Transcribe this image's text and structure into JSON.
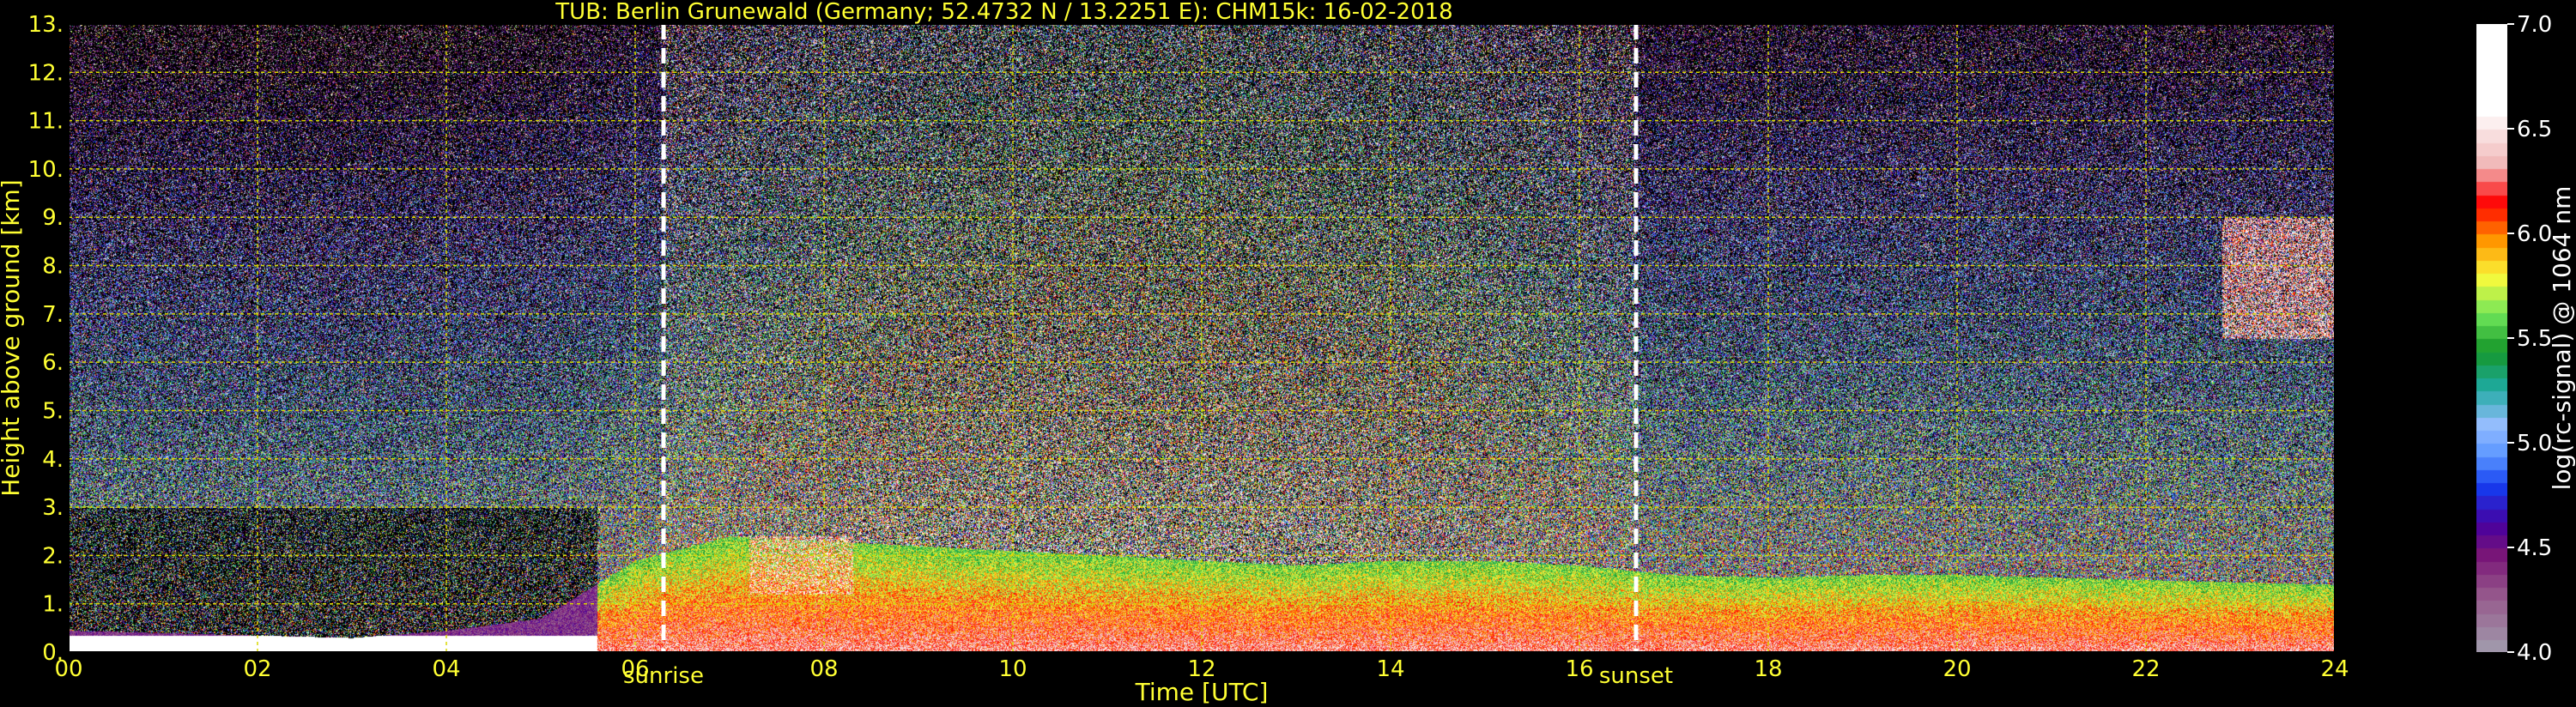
{
  "chart_data": {
    "type": "heatmap",
    "title": "TUB: Berlin Grunewald (Germany; 52.4732 N / 13.2251 E):    CHM15k: 16-02-2018",
    "xlabel": "Time [UTC]",
    "ylabel": "Height above ground [km]",
    "xlim": [
      0,
      24
    ],
    "ylim": [
      0,
      13
    ],
    "x_ticks": [
      "00",
      "02",
      "04",
      "06",
      "08",
      "10",
      "12",
      "14",
      "16",
      "18",
      "20",
      "22",
      "24"
    ],
    "y_ticks": [
      "0.",
      "1.",
      "2.",
      "3.",
      "4.",
      "5.",
      "6.",
      "7.",
      "8.",
      "9.",
      "10.",
      "11.",
      "12.",
      "13."
    ],
    "grid": true,
    "colorbar": {
      "label": "log(rc-signal) @ 1064 nm",
      "range": [
        4.0,
        7.0
      ],
      "ticks": [
        "4.0",
        "4.5",
        "5.0",
        "5.5",
        "6.0",
        "6.5",
        "7.0"
      ]
    },
    "annotations": [
      {
        "label": "sunrise",
        "x": 6.3
      },
      {
        "label": "sunset",
        "x": 16.6
      }
    ],
    "boundary_layer_top_km": [
      [
        0,
        0.45
      ],
      [
        1,
        0.4
      ],
      [
        2,
        0.35
      ],
      [
        3,
        0.3
      ],
      [
        4,
        0.45
      ],
      [
        5,
        0.7
      ],
      [
        6,
        1.9
      ],
      [
        7,
        2.4
      ],
      [
        8,
        2.3
      ],
      [
        9,
        2.2
      ],
      [
        10,
        2.1
      ],
      [
        11,
        2.0
      ],
      [
        12,
        1.9
      ],
      [
        13,
        1.8
      ],
      [
        14,
        1.9
      ],
      [
        15,
        1.9
      ],
      [
        16,
        1.8
      ],
      [
        17,
        1.6
      ],
      [
        18,
        1.55
      ],
      [
        19,
        1.6
      ],
      [
        20,
        1.6
      ],
      [
        21,
        1.55
      ],
      [
        22,
        1.5
      ],
      [
        23,
        1.45
      ],
      [
        24,
        1.4
      ]
    ],
    "cloud_features": [
      {
        "x": [
          22.8,
          24.0
        ],
        "y": [
          6.5,
          9.0
        ]
      },
      {
        "x": [
          7.2,
          8.3
        ],
        "y": [
          1.2,
          2.4
        ]
      }
    ]
  }
}
